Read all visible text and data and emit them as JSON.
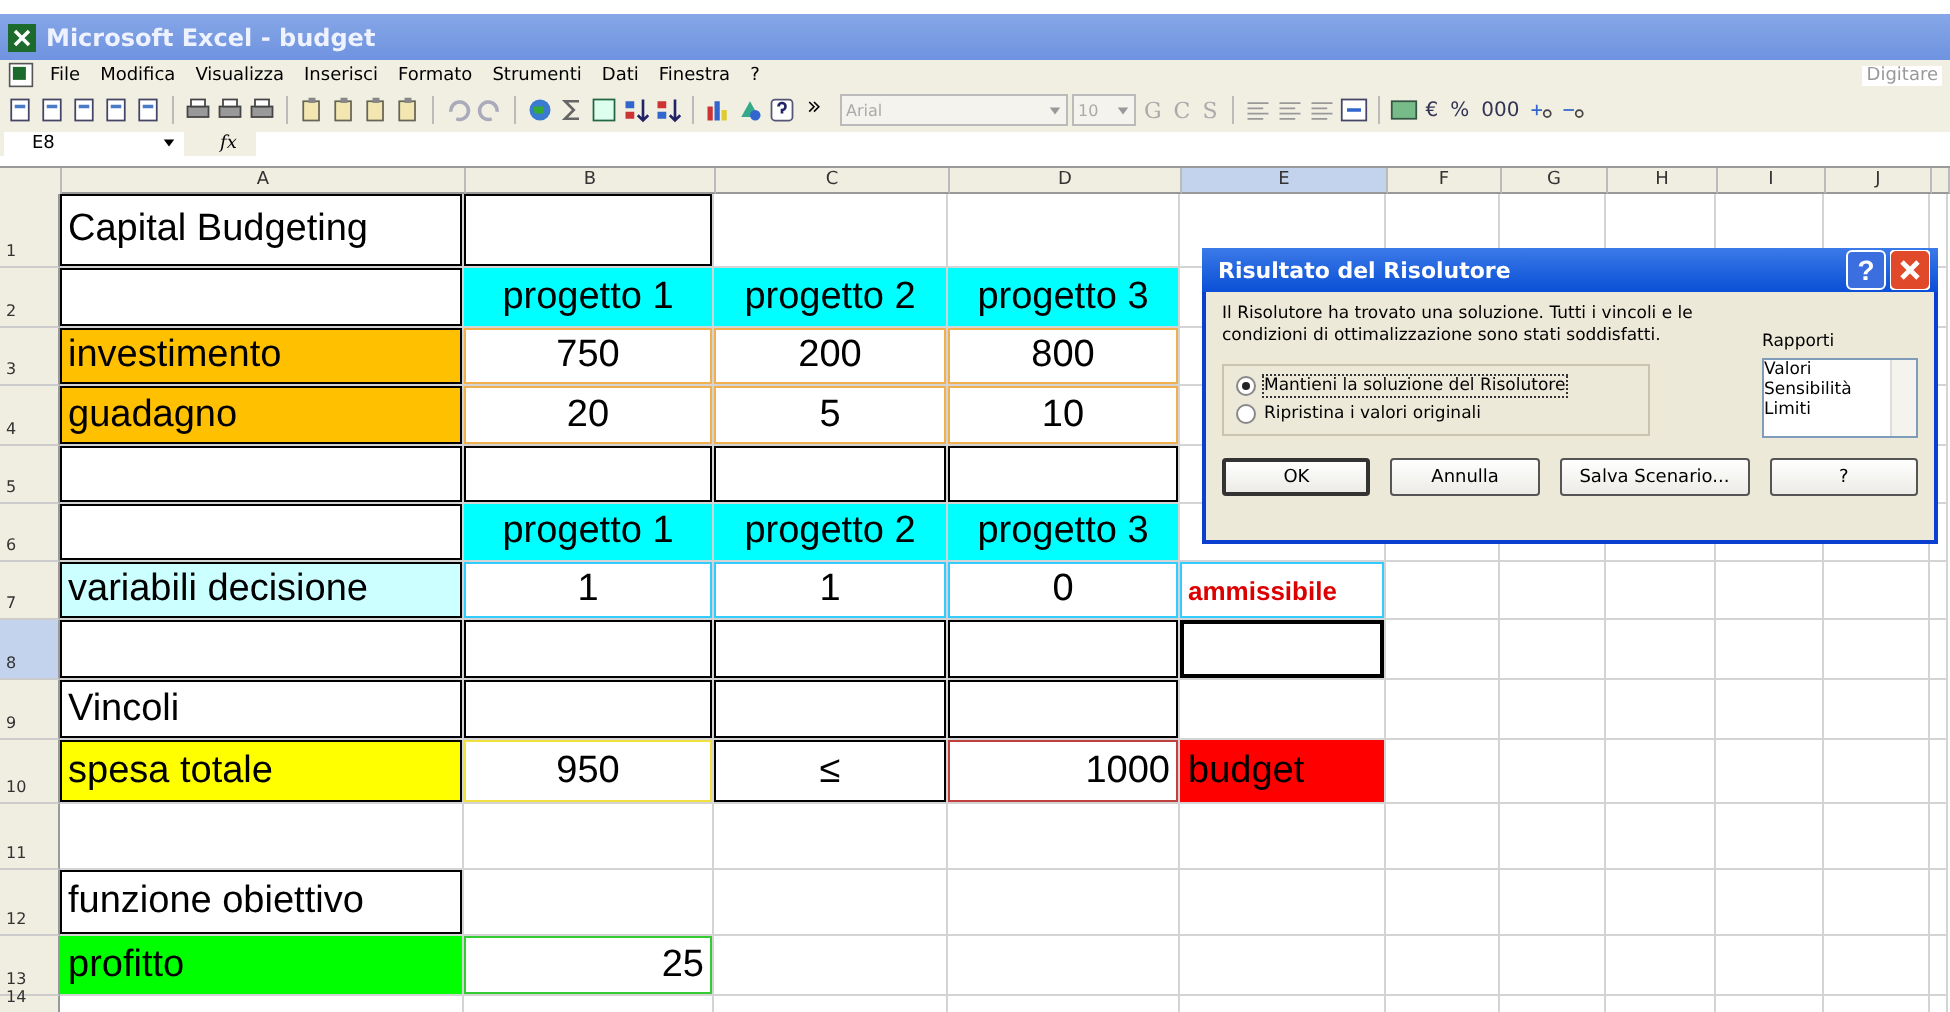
{
  "window": {
    "title": "Microsoft Excel - budget"
  },
  "menu": [
    "File",
    "Modifica",
    "Visualizza",
    "Inserisci",
    "Formato",
    "Strumenti",
    "Dati",
    "Finestra",
    "?"
  ],
  "help_box": {
    "placeholder": "Digitare"
  },
  "toolbar": {
    "font": "Arial",
    "size": "10",
    "format_buttons": [
      "G",
      "C",
      "S"
    ],
    "number_buttons": [
      "€",
      "%",
      "000"
    ]
  },
  "formula_bar": {
    "name_box": "E8",
    "fx": "fx"
  },
  "columns": [
    {
      "label": "A",
      "selected": false
    },
    {
      "label": "B",
      "selected": false
    },
    {
      "label": "C",
      "selected": false
    },
    {
      "label": "D",
      "selected": false
    },
    {
      "label": "E",
      "selected": true
    },
    {
      "label": "F",
      "selected": false
    },
    {
      "label": "G",
      "selected": false
    },
    {
      "label": "H",
      "selected": false
    },
    {
      "label": "I",
      "selected": false
    },
    {
      "label": "J",
      "selected": false
    }
  ],
  "rows": [
    {
      "label": "1",
      "selected": false,
      "cells": [
        {
          "text": "Capital Budgeting",
          "outline": {
            "color": "#000000"
          }
        },
        {
          "outline": {
            "color": "#000000"
          }
        },
        {},
        {},
        {}
      ]
    },
    {
      "label": "2",
      "selected": false,
      "cells": [
        {
          "outline": {
            "color": "#000000"
          }
        },
        {
          "text": "progetto 1",
          "color": "#00ffff",
          "centered": true
        },
        {
          "text": "progetto 2",
          "color": "#00ffff",
          "centered": true
        },
        {
          "text": "progetto 3",
          "color": "#00ffff",
          "centered": true
        },
        {}
      ]
    },
    {
      "label": "3",
      "selected": false,
      "cells": [
        {
          "text": "investimento",
          "color": "#ffc000",
          "outline": {
            "color": "#000000"
          }
        },
        {
          "text": "750",
          "centered": true,
          "outline": {
            "color": "#f0b050"
          }
        },
        {
          "text": "200",
          "centered": true,
          "outline": {
            "color": "#f0b050"
          }
        },
        {
          "text": "800",
          "centered": true,
          "outline": {
            "color": "#f0b050"
          }
        },
        {}
      ]
    },
    {
      "label": "4",
      "selected": false,
      "cells": [
        {
          "text": "guadagno",
          "color": "#ffc000",
          "outline": {
            "color": "#000000"
          }
        },
        {
          "text": "20",
          "centered": true,
          "outline": {
            "color": "#f0b050"
          }
        },
        {
          "text": "5",
          "centered": true,
          "outline": {
            "color": "#f0b050"
          }
        },
        {
          "text": "10",
          "centered": true,
          "outline": {
            "color": "#f0b050"
          }
        },
        {}
      ]
    },
    {
      "label": "5",
      "selected": false,
      "cells": [
        {
          "outline": {
            "color": "#000000"
          }
        },
        {
          "outline": {
            "color": "#000000"
          }
        },
        {
          "outline": {
            "color": "#000000"
          }
        },
        {
          "outline": {
            "color": "#000000"
          }
        },
        {}
      ]
    },
    {
      "label": "6",
      "selected": false,
      "cells": [
        {
          "outline": {
            "color": "#000000"
          }
        },
        {
          "text": "progetto 1",
          "color": "#00ffff",
          "centered": true
        },
        {
          "text": "progetto 2",
          "color": "#00ffff",
          "centered": true
        },
        {
          "text": "progetto 3",
          "color": "#00ffff",
          "centered": true
        },
        {}
      ]
    },
    {
      "label": "7",
      "selected": false,
      "cells": [
        {
          "text": "variabili decisione",
          "color": "#ccffff",
          "outline": {
            "color": "#000000"
          }
        },
        {
          "text": "1",
          "centered": true,
          "outline": {
            "color": "#33ccff"
          }
        },
        {
          "text": "1",
          "centered": true,
          "outline": {
            "color": "#33ccff"
          }
        },
        {
          "text": "0",
          "centered": true,
          "outline": {
            "color": "#33ccff"
          }
        },
        {
          "text": "ammissibile",
          "ink": {
            "color": "#dd0000"
          },
          "outline": {
            "color": "#33ccff"
          },
          "bold": true
        }
      ]
    },
    {
      "label": "8",
      "selected": true,
      "cells": [
        {
          "outline": {
            "color": "#000000"
          }
        },
        {
          "outline": {
            "color": "#000000"
          }
        },
        {
          "outline": {
            "color": "#000000"
          }
        },
        {
          "outline": {
            "color": "#000000"
          }
        },
        {
          "selected": true
        }
      ]
    },
    {
      "label": "9",
      "selected": false,
      "cells": [
        {
          "text": "Vincoli",
          "outline": {
            "color": "#000000"
          }
        },
        {
          "outline": {
            "color": "#000000"
          }
        },
        {
          "outline": {
            "color": "#000000"
          }
        },
        {
          "outline": {
            "color": "#000000"
          }
        },
        {}
      ]
    },
    {
      "label": "10",
      "selected": false,
      "cells": [
        {
          "text": "spesa totale",
          "color": "#ffff00",
          "outline": {
            "color": "#000000"
          }
        },
        {
          "text": "950",
          "centered": true,
          "outline": {
            "color": "#f0e040"
          }
        },
        {
          "text": "≤",
          "centered": true,
          "outline": {
            "color": "#000000"
          }
        },
        {
          "text": "1000",
          "right": true,
          "outline": {
            "color": "#c04040"
          }
        },
        {
          "text": "budget",
          "color": "#ff0000"
        }
      ]
    },
    {
      "label": "11",
      "selected": false,
      "cells": [
        {},
        {},
        {},
        {},
        {}
      ]
    },
    {
      "label": "12",
      "selected": false,
      "cells": [
        {
          "text": "funzione obiettivo",
          "outline": {
            "color": "#000000"
          }
        },
        {},
        {},
        {},
        {}
      ]
    },
    {
      "label": "13",
      "selected": false,
      "cells": [
        {
          "text": "profitto",
          "color": "#00ff00"
        },
        {
          "text": "25",
          "right": true,
          "outline": {
            "color": "#33cc33"
          }
        },
        {},
        {},
        {}
      ]
    },
    {
      "label": "14",
      "selected": false,
      "cells": [
        {},
        {},
        {},
        {},
        {}
      ]
    }
  ],
  "dialog": {
    "title": "Risultato del Risolutore",
    "message": "Il Risolutore ha trovato una soluzione. Tutti i vincoli e le condizioni di ottimalizzazione sono stati soddisfatti.",
    "options": [
      {
        "label": "Mantieni la soluzione del Risolutore",
        "selected": true
      },
      {
        "label": "Ripristina i valori originali",
        "selected": false
      }
    ],
    "reports_label": "Rapporti",
    "reports": [
      "Valori",
      "Sensibilità",
      "Limiti"
    ],
    "buttons": [
      "OK",
      "Annulla",
      "Salva Scenario...",
      "?"
    ],
    "help": "?"
  }
}
